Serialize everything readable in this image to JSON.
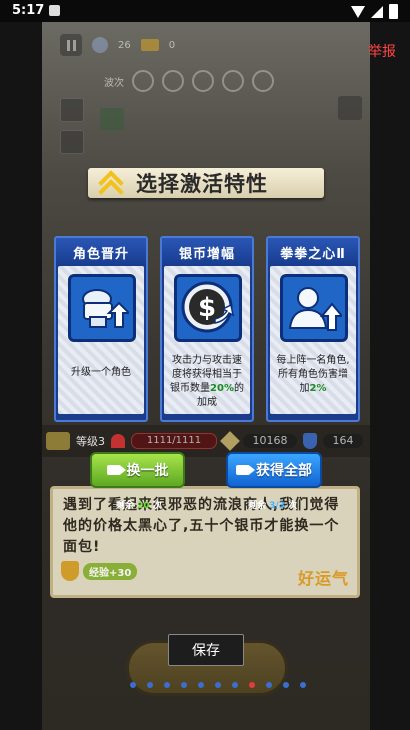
{
  "status_bar": {
    "time": "5:17"
  },
  "report_link": "举报",
  "hud": {
    "gems": "26",
    "tickets": "0",
    "wave_label": "波次"
  },
  "banner": {
    "title": "选择激活特性"
  },
  "cards": [
    {
      "title": "角色晋升",
      "desc_lines": [
        "升级一个角色"
      ],
      "icon": "toilet-upgrade-icon"
    },
    {
      "title": "银币增幅",
      "desc_pre": "攻击力与攻击速度将获得相当于银币数量",
      "desc_highlight": "20%",
      "desc_post": "的加成",
      "icon": "silver-coin-icon"
    },
    {
      "title": "拳拳之心Ⅱ",
      "desc_pre": "每上阵一名角色,所有角色伤害增加",
      "desc_highlight": "2%",
      "desc_post": "",
      "icon": "person-upgrade-icon"
    }
  ],
  "stats": {
    "level": "等级3",
    "hp": "1111/1111",
    "attack": "10168",
    "defense": "164"
  },
  "buttons": {
    "refresh": {
      "label": "换一批",
      "remain_prefix": "剩余",
      "remain_count": "20",
      "remain_suffix": "次"
    },
    "get_all": {
      "label": "获得全部",
      "remain_prefix": "剩余",
      "remain_count": "3/3",
      "remain_suffix": "次"
    }
  },
  "dialog": {
    "text": "遇到了看起来很邪恶的流浪商人,我们觉得他的价格太黑心了,五十个银币才能换一个面包!",
    "exp": "经验+30",
    "luck": "好运气"
  },
  "save_tooltip": "保存",
  "pager": {
    "total": 11,
    "active_index": 7
  },
  "colors": {
    "card_blue": "#1b3c8a",
    "highlight_green": "#1b8a23",
    "report_red": "#ff4444"
  }
}
